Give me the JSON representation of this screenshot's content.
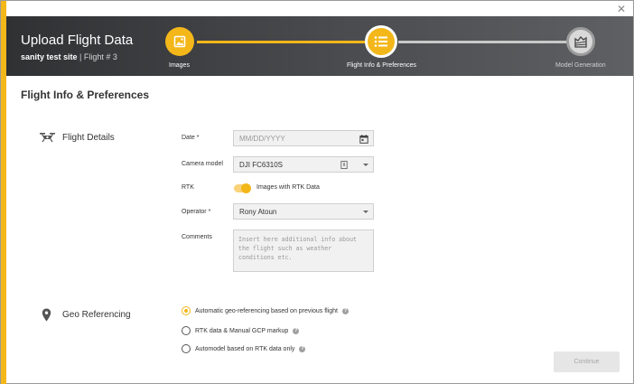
{
  "window": {
    "close_label": "✕"
  },
  "header": {
    "title": "Upload Flight Data",
    "site": "sanity test site",
    "flight": "| Flight # 3"
  },
  "steps": [
    {
      "label": "Images",
      "icon": "image-icon",
      "state": "done"
    },
    {
      "label": "Flight Info & Preferences",
      "icon": "list-icon",
      "state": "active"
    },
    {
      "label": "Model Generation",
      "icon": "model-icon",
      "state": "todo"
    }
  ],
  "section": {
    "title": "Flight Info & Preferences"
  },
  "flight_details": {
    "heading": "Flight Details",
    "icon": "drone-icon",
    "date": {
      "label": "Date *",
      "placeholder": "MM/DD/YYYY"
    },
    "camera": {
      "label": "Camera model",
      "value": "DJI FC6310S"
    },
    "rtk": {
      "label": "RTK",
      "toggle_text": "Images with RTK Data",
      "enabled": true
    },
    "operator": {
      "label": "Operator *",
      "value": "Rony Atoun"
    },
    "comments": {
      "label": "Comments",
      "placeholder": "Insert here additional info about the flight such as weather conditions etc."
    }
  },
  "geo_referencing": {
    "heading": "Geo Referencing",
    "icon": "map-pin-icon",
    "options": [
      {
        "label": "Automatic geo-referencing based on previous flight",
        "selected": true
      },
      {
        "label": "RTK data & Manual GCP markup",
        "selected": false
      },
      {
        "label": "Automodel based on RTK data only",
        "selected": false
      }
    ]
  },
  "actions": {
    "continue_label": "Continue"
  },
  "colors": {
    "accent": "#f4b71a",
    "header_dark": "#2f3133",
    "disabled": "#e6e6e6"
  }
}
